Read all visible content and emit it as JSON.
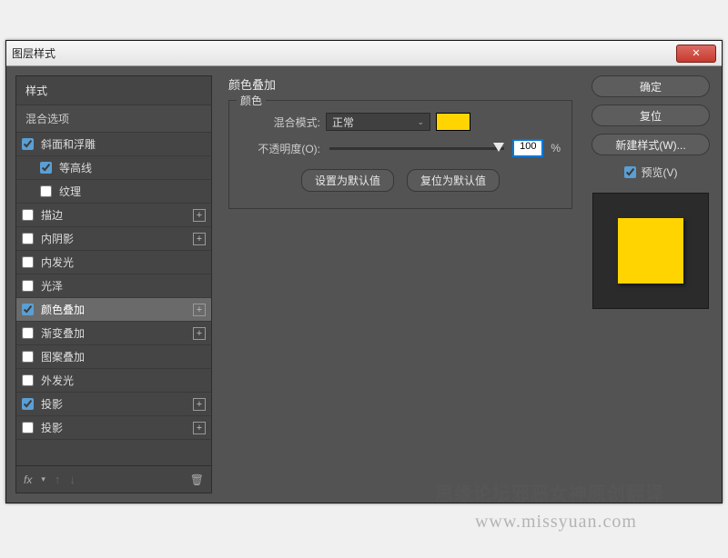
{
  "window": {
    "title": "图层样式"
  },
  "left": {
    "header": "样式",
    "blend_options": "混合选项",
    "items": [
      {
        "label": "斜面和浮雕",
        "checked": true,
        "indent": false,
        "add": false
      },
      {
        "label": "等高线",
        "checked": true,
        "indent": true,
        "add": false
      },
      {
        "label": "纹理",
        "checked": false,
        "indent": true,
        "add": false
      },
      {
        "label": "描边",
        "checked": false,
        "indent": false,
        "add": true
      },
      {
        "label": "内阴影",
        "checked": false,
        "indent": false,
        "add": true
      },
      {
        "label": "内发光",
        "checked": false,
        "indent": false,
        "add": false
      },
      {
        "label": "光泽",
        "checked": false,
        "indent": false,
        "add": false
      },
      {
        "label": "颜色叠加",
        "checked": true,
        "indent": false,
        "add": true,
        "selected": true
      },
      {
        "label": "渐变叠加",
        "checked": false,
        "indent": false,
        "add": true
      },
      {
        "label": "图案叠加",
        "checked": false,
        "indent": false,
        "add": false
      },
      {
        "label": "外发光",
        "checked": false,
        "indent": false,
        "add": false
      },
      {
        "label": "投影",
        "checked": true,
        "indent": false,
        "add": true
      },
      {
        "label": "投影",
        "checked": false,
        "indent": false,
        "add": true
      }
    ],
    "footer_fx": "fx"
  },
  "center": {
    "title": "颜色叠加",
    "group_label": "颜色",
    "blend_mode_label": "混合模式:",
    "blend_mode_value": "正常",
    "opacity_label": "不透明度(O):",
    "opacity_value": "100",
    "opacity_pct": "%",
    "set_default": "设置为默认值",
    "reset_default": "复位为默认值",
    "swatch_color": "#ffd400"
  },
  "right": {
    "ok": "确定",
    "reset": "复位",
    "new_style": "新建样式(W)...",
    "preview_label": "预览(V)",
    "preview_checked": true,
    "preview_color": "#ffd400"
  },
  "watermark": {
    "line1": "思缘论坛邪恶女神原创翻译",
    "line2": "www.missyuan.com"
  }
}
